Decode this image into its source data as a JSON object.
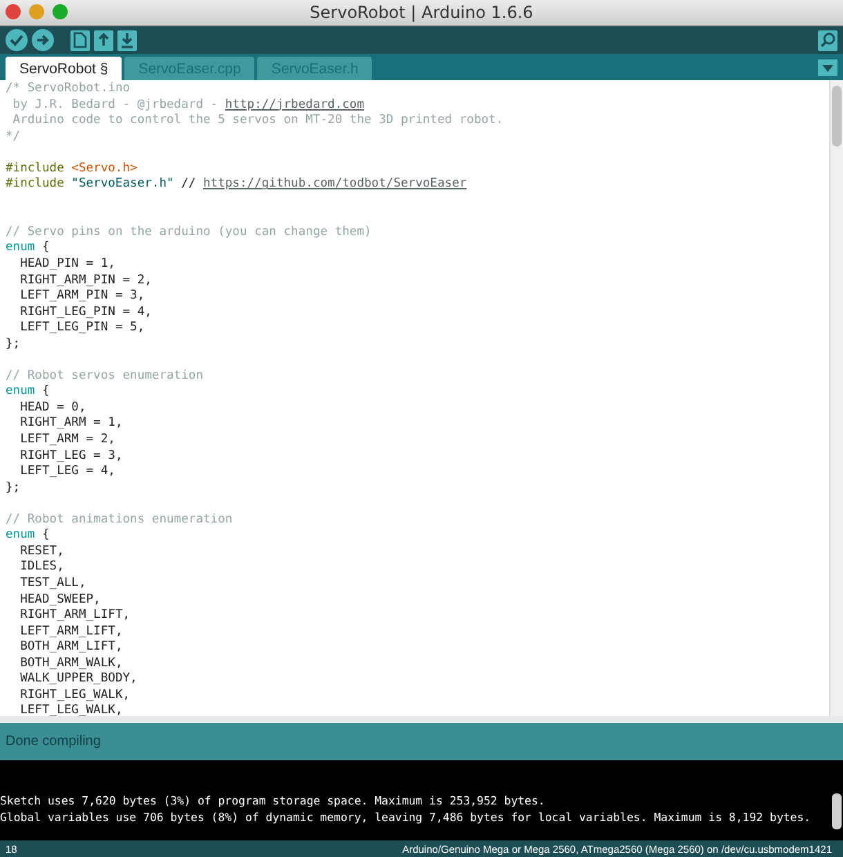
{
  "window": {
    "title": "ServoRobot | Arduino 1.6.6"
  },
  "tabs": [
    {
      "label": "ServoRobot §",
      "selected": true
    },
    {
      "label": "ServoEaser.cpp",
      "selected": false
    },
    {
      "label": "ServoEaser.h",
      "selected": false
    }
  ],
  "editor": {
    "lines": [
      {
        "kind": "code",
        "tokens": [
          {
            "kind": "comment",
            "text": "/* ServoRobot.ino"
          }
        ]
      },
      {
        "kind": "code",
        "tokens": [
          {
            "kind": "comment",
            "text": " by J.R. Bedard - @jrbedard - "
          },
          {
            "kind": "link",
            "text": "http://jrbedard.com"
          }
        ]
      },
      {
        "kind": "code",
        "tokens": [
          {
            "kind": "comment",
            "text": " Arduino code to control the 5 servos on MT-20 the 3D printed robot."
          }
        ]
      },
      {
        "kind": "code",
        "tokens": [
          {
            "kind": "comment",
            "text": "*/"
          }
        ]
      },
      {
        "kind": "blank"
      },
      {
        "kind": "code",
        "tokens": [
          {
            "kind": "preproc",
            "text": "#include"
          },
          {
            "kind": "header",
            "text": "<Servo.h>"
          }
        ]
      },
      {
        "kind": "code",
        "tokens": [
          {
            "kind": "preproc",
            "text": "#include"
          },
          {
            "kind": "string",
            "text": "\"ServoEaser.h\""
          },
          {
            "kind": "plain",
            "text": " // "
          },
          {
            "kind": "link",
            "text": "https://github.com/todbot/ServoEaser"
          }
        ]
      },
      {
        "kind": "blank"
      },
      {
        "kind": "blank"
      },
      {
        "kind": "code",
        "tokens": [
          {
            "kind": "comment",
            "text": "// Servo pins on the arduino (you can change them)"
          }
        ]
      },
      {
        "kind": "code",
        "tokens": [
          {
            "kind": "keyword",
            "text": "enum"
          },
          {
            "kind": "plain",
            "text": " {"
          }
        ]
      },
      {
        "kind": "code",
        "tokens": [
          {
            "kind": "plain",
            "text": "  HEAD_PIN = 1,"
          }
        ]
      },
      {
        "kind": "code",
        "tokens": [
          {
            "kind": "plain",
            "text": "  RIGHT_ARM_PIN = 2,"
          }
        ]
      },
      {
        "kind": "code",
        "tokens": [
          {
            "kind": "plain",
            "text": "  LEFT_ARM_PIN = 3,"
          }
        ]
      },
      {
        "kind": "code",
        "tokens": [
          {
            "kind": "plain",
            "text": "  RIGHT_LEG_PIN = 4,"
          }
        ]
      },
      {
        "kind": "code",
        "tokens": [
          {
            "kind": "plain",
            "text": "  LEFT_LEG_PIN = 5,"
          }
        ]
      },
      {
        "kind": "code",
        "tokens": [
          {
            "kind": "plain",
            "text": "};"
          }
        ]
      },
      {
        "kind": "blank"
      },
      {
        "kind": "code",
        "tokens": [
          {
            "kind": "comment",
            "text": "// Robot servos enumeration"
          }
        ]
      },
      {
        "kind": "code",
        "tokens": [
          {
            "kind": "keyword",
            "text": "enum"
          },
          {
            "kind": "plain",
            "text": " {"
          }
        ]
      },
      {
        "kind": "code",
        "tokens": [
          {
            "kind": "plain",
            "text": "  HEAD = 0,"
          }
        ]
      },
      {
        "kind": "code",
        "tokens": [
          {
            "kind": "plain",
            "text": "  RIGHT_ARM = 1,"
          }
        ]
      },
      {
        "kind": "code",
        "tokens": [
          {
            "kind": "plain",
            "text": "  LEFT_ARM = 2,"
          }
        ]
      },
      {
        "kind": "code",
        "tokens": [
          {
            "kind": "plain",
            "text": "  RIGHT_LEG = 3,"
          }
        ]
      },
      {
        "kind": "code",
        "tokens": [
          {
            "kind": "plain",
            "text": "  LEFT_LEG = 4,"
          }
        ]
      },
      {
        "kind": "code",
        "tokens": [
          {
            "kind": "plain",
            "text": "};"
          }
        ]
      },
      {
        "kind": "blank"
      },
      {
        "kind": "code",
        "tokens": [
          {
            "kind": "comment",
            "text": "// Robot animations enumeration"
          }
        ]
      },
      {
        "kind": "code",
        "tokens": [
          {
            "kind": "keyword",
            "text": "enum"
          },
          {
            "kind": "plain",
            "text": " {"
          }
        ]
      },
      {
        "kind": "code",
        "tokens": [
          {
            "kind": "plain",
            "text": "  RESET,"
          }
        ]
      },
      {
        "kind": "code",
        "tokens": [
          {
            "kind": "plain",
            "text": "  IDLES,"
          }
        ]
      },
      {
        "kind": "code",
        "tokens": [
          {
            "kind": "plain",
            "text": "  TEST_ALL,"
          }
        ]
      },
      {
        "kind": "code",
        "tokens": [
          {
            "kind": "plain",
            "text": "  HEAD_SWEEP,"
          }
        ]
      },
      {
        "kind": "code",
        "tokens": [
          {
            "kind": "plain",
            "text": "  RIGHT_ARM_LIFT,"
          }
        ]
      },
      {
        "kind": "code",
        "tokens": [
          {
            "kind": "plain",
            "text": "  LEFT_ARM_LIFT,"
          }
        ]
      },
      {
        "kind": "code",
        "tokens": [
          {
            "kind": "plain",
            "text": "  BOTH_ARM_LIFT,"
          }
        ]
      },
      {
        "kind": "code",
        "tokens": [
          {
            "kind": "plain",
            "text": "  BOTH_ARM_WALK,"
          }
        ]
      },
      {
        "kind": "code",
        "tokens": [
          {
            "kind": "plain",
            "text": "  WALK_UPPER_BODY,"
          }
        ]
      },
      {
        "kind": "code",
        "tokens": [
          {
            "kind": "plain",
            "text": "  RIGHT_LEG_WALK,"
          }
        ]
      },
      {
        "kind": "code",
        "tokens": [
          {
            "kind": "plain",
            "text": "  LEFT_LEG_WALK,"
          }
        ]
      }
    ]
  },
  "status": {
    "message": "Done compiling"
  },
  "console": {
    "lines": [
      "Sketch uses 7,620 bytes (3%) of program storage space. Maximum is 253,952 bytes.",
      "Global variables use 706 bytes (8%) of dynamic memory, leaving 7,486 bytes for local variables. Maximum is 8,192 bytes."
    ]
  },
  "footer": {
    "line_number": "18",
    "board": "Arduino/Genuino Mega or Mega 2560, ATmega2560 (Mega 2560) on /dev/cu.usbmodem1421"
  }
}
